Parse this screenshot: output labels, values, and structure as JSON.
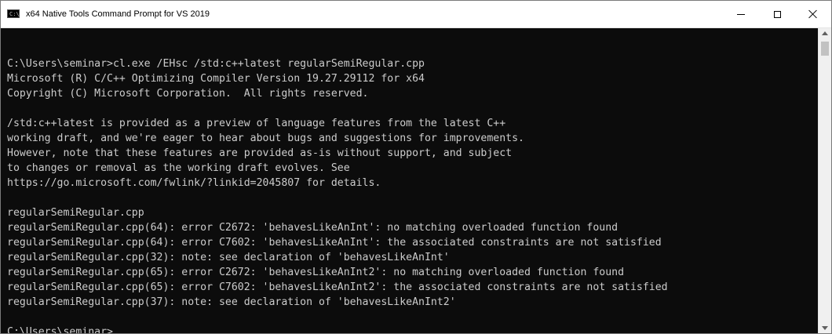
{
  "window": {
    "title": "x64 Native Tools Command Prompt for VS 2019",
    "icon": "terminal-icon",
    "icon_text": "C:\\"
  },
  "colors": {
    "console_bg": "#0c0c0c",
    "console_text": "#cccccc",
    "titlebar_bg": "#ffffff"
  },
  "console": {
    "lines": [
      "",
      "C:\\Users\\seminar>cl.exe /EHsc /std:c++latest regularSemiRegular.cpp",
      "Microsoft (R) C/C++ Optimizing Compiler Version 19.27.29112 for x64",
      "Copyright (C) Microsoft Corporation.  All rights reserved.",
      "",
      "/std:c++latest is provided as a preview of language features from the latest C++",
      "working draft, and we're eager to hear about bugs and suggestions for improvements.",
      "However, note that these features are provided as-is without support, and subject",
      "to changes or removal as the working draft evolves. See",
      "https://go.microsoft.com/fwlink/?linkid=2045807 for details.",
      "",
      "regularSemiRegular.cpp",
      "regularSemiRegular.cpp(64): error C2672: 'behavesLikeAnInt': no matching overloaded function found",
      "regularSemiRegular.cpp(64): error C7602: 'behavesLikeAnInt': the associated constraints are not satisfied",
      "regularSemiRegular.cpp(32): note: see declaration of 'behavesLikeAnInt'",
      "regularSemiRegular.cpp(65): error C2672: 'behavesLikeAnInt2': no matching overloaded function found",
      "regularSemiRegular.cpp(65): error C7602: 'behavesLikeAnInt2': the associated constraints are not satisfied",
      "regularSemiRegular.cpp(37): note: see declaration of 'behavesLikeAnInt2'",
      "",
      "C:\\Users\\seminar>"
    ]
  }
}
